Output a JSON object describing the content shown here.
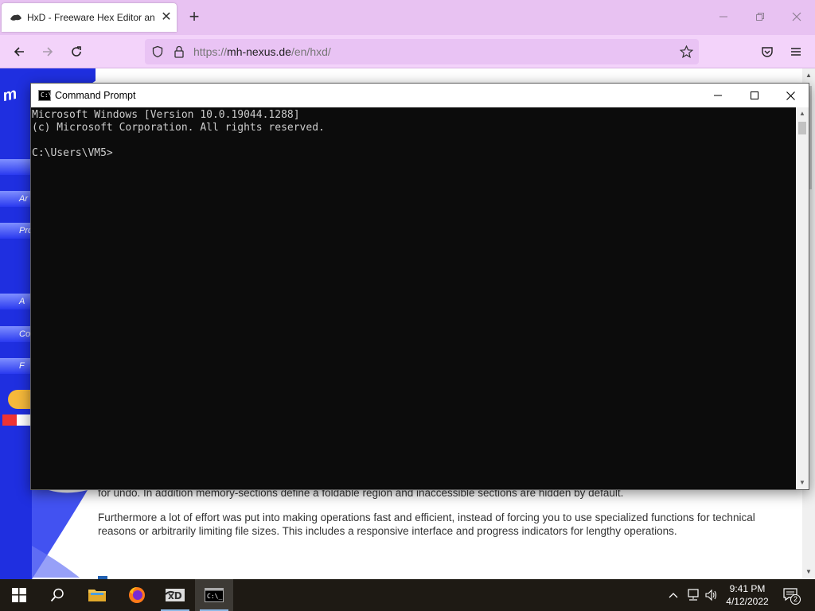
{
  "browser": {
    "tab_title": "HxD - Freeware Hex Editor and Disk Editor",
    "tab_close": "✕",
    "new_tab": "+",
    "url_domain": "mh-nexus.de",
    "url_prefix": "https://",
    "url_path": "/en/hxd/"
  },
  "webpage": {
    "paragraph1": "for undo. In addition memory-sections define a foldable region and inaccessible sections are hidden by default.",
    "paragraph2": "Furthermore a lot of effort was put into making operations fast and efficient, instead of forcing you to use specialized functions for technical reasons or arbitrarily limiting file sizes. This includes a responsive interface and progress indicators for lengthy operations.",
    "nav_fragments": [
      "",
      "Ar",
      "Pro",
      "",
      "A",
      "Co",
      "F"
    ]
  },
  "cmd": {
    "title": "Command Prompt",
    "icon_text": "C:\\_",
    "lines": [
      "Microsoft Windows [Version 10.0.19044.1288]",
      "(c) Microsoft Corporation. All rights reserved.",
      "",
      "C:\\Users\\VM5>"
    ]
  },
  "taskbar": {
    "time": "9:41 PM",
    "date": "4/12/2022",
    "notification_count": "2",
    "apps": [
      "start",
      "search",
      "file-explorer",
      "firefox",
      "hxd",
      "command-prompt"
    ]
  },
  "colors": {
    "browser_tabstrip": "#e8c2f2",
    "browser_navbar": "#f3d3fa",
    "console_bg": "#0c0c0c",
    "console_fg": "#cccccc",
    "site_blue": "#1f2fe0",
    "taskbar_bg": "#1e1a14"
  }
}
